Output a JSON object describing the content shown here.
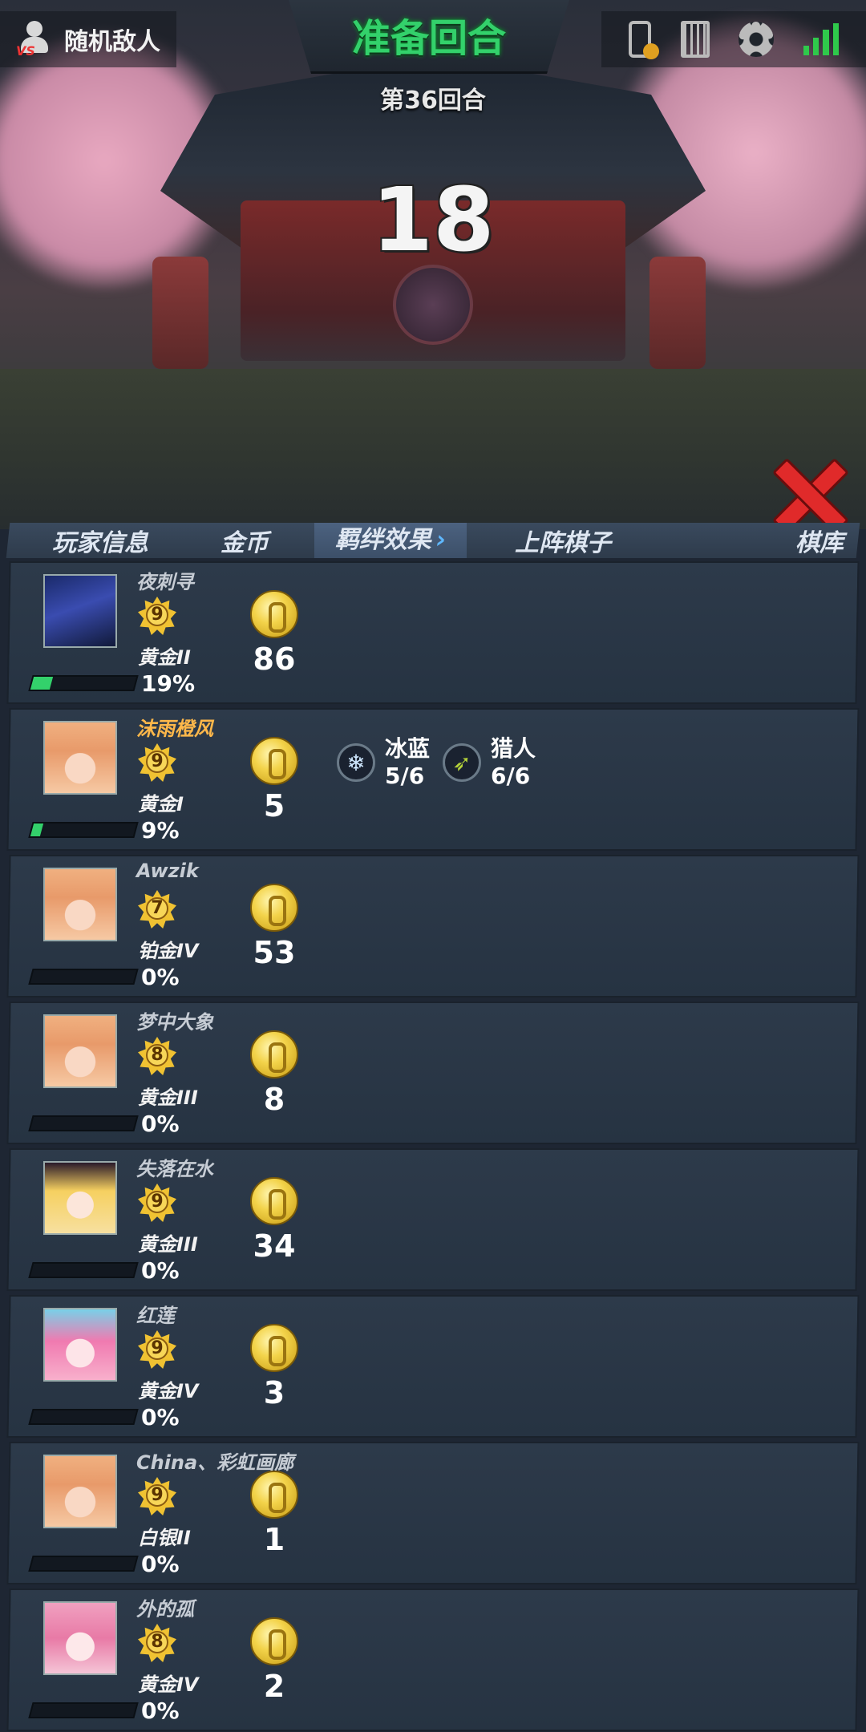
{
  "hud": {
    "opponent_label": "随机敌人",
    "phase_title": "准备回合",
    "round_label": "第36回合",
    "countdown": "18"
  },
  "table": {
    "headers": {
      "player_info": "玩家信息",
      "gold": "金币",
      "bonds": "羁绊效果",
      "deployed": "上阵棋子",
      "library": "棋库"
    }
  },
  "players": [
    {
      "name": "夜刺寻",
      "level": "9",
      "rank": "黄金II",
      "exp": 0.19,
      "exp_label": "19%",
      "gold": "86",
      "highlight": false,
      "avatar": "dark-swordsman",
      "bonds": []
    },
    {
      "name": "沫雨橙风",
      "level": "9",
      "rank": "黄金I",
      "exp": 0.09,
      "exp_label": "9%",
      "gold": "5",
      "highlight": true,
      "avatar": "orange-hair-girl",
      "bonds": [
        {
          "name": "冰蓝",
          "count": "5/6",
          "icon": "snowflake-icon"
        },
        {
          "name": "猎人",
          "count": "6/6",
          "icon": "bow-icon"
        }
      ]
    },
    {
      "name": "Awzik",
      "level": "7",
      "rank": "铂金IV",
      "exp": 0,
      "exp_label": "0%",
      "gold": "53",
      "highlight": false,
      "avatar": "orange-hair-girl",
      "bonds": []
    },
    {
      "name": "梦中大象",
      "level": "8",
      "rank": "黄金III",
      "exp": 0,
      "exp_label": "0%",
      "gold": "8",
      "highlight": false,
      "avatar": "orange-hair-girl",
      "bonds": []
    },
    {
      "name": "失落在水",
      "level": "9",
      "rank": "黄金III",
      "exp": 0,
      "exp_label": "0%",
      "gold": "34",
      "highlight": false,
      "avatar": "cat-ear-girl",
      "bonds": []
    },
    {
      "name": "红莲",
      "level": "9",
      "rank": "黄金IV",
      "exp": 0,
      "exp_label": "0%",
      "gold": "3",
      "highlight": false,
      "avatar": "pink-fox-girl",
      "bonds": []
    },
    {
      "name": "China、彩虹画廊",
      "level": "9",
      "rank": "白银II",
      "exp": 0,
      "exp_label": "0%",
      "gold": "1",
      "highlight": false,
      "avatar": "orange-hair-girl",
      "bonds": []
    },
    {
      "name": "外的孤",
      "level": "8",
      "rank": "黄金IV",
      "exp": 0,
      "exp_label": "0%",
      "gold": "2",
      "highlight": false,
      "avatar": "pink-bow-girl",
      "bonds": []
    }
  ],
  "colors": {
    "accent_green": "#33d16b",
    "highlight_name": "#ffb84a",
    "close_red": "#e02a2a",
    "row_bg": "#2d3a4a"
  }
}
